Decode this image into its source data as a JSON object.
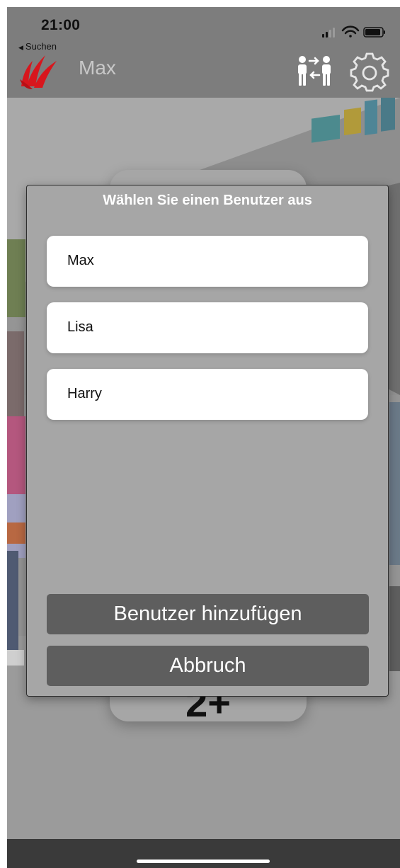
{
  "status_bar": {
    "time": "21:00",
    "back_label": "Suchen"
  },
  "header": {
    "title": "Max",
    "brand_color": "#d8161d"
  },
  "background_card": {
    "text": "2+"
  },
  "dialog": {
    "title": "Wählen Sie einen Benutzer aus",
    "users": [
      {
        "name": "Max"
      },
      {
        "name": "Lisa"
      },
      {
        "name": "Harry"
      }
    ],
    "add_user_label": "Benutzer hinzufügen",
    "cancel_label": "Abbruch"
  },
  "icons": {
    "logo": "brand-logo-icon",
    "switch_user": "switch-user-icon",
    "settings": "gear-icon",
    "signal": "signal-icon",
    "wifi": "wifi-icon",
    "battery": "battery-icon"
  }
}
